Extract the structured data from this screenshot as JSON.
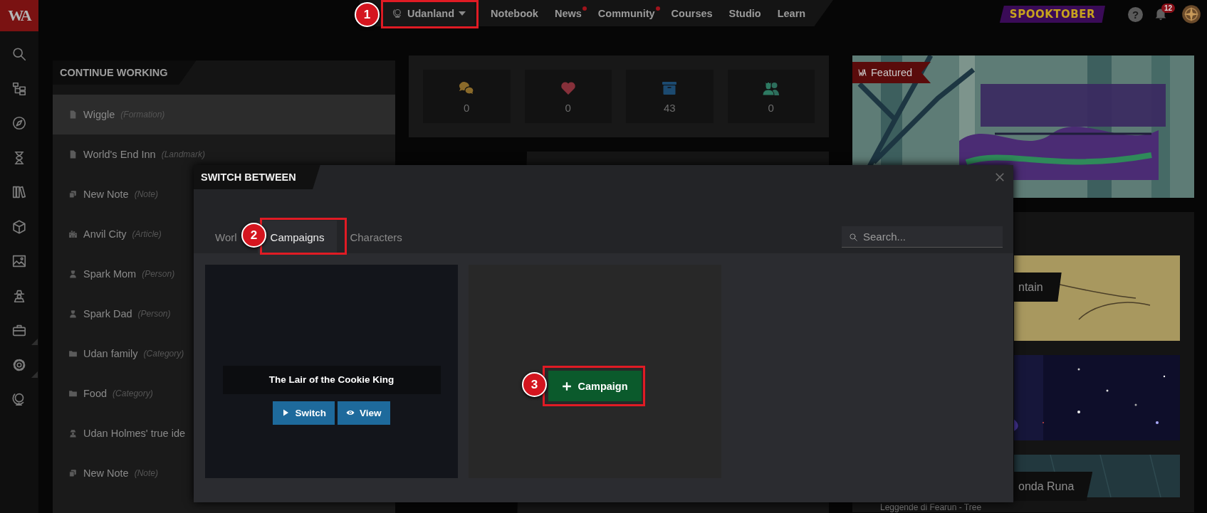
{
  "topbar": {
    "logo": "WA",
    "world": {
      "label": "Udanland"
    },
    "nav": [
      {
        "label": "Notebook",
        "unread": false
      },
      {
        "label": "News",
        "unread": true
      },
      {
        "label": "Community",
        "unread": true
      },
      {
        "label": "Courses",
        "unread": false
      },
      {
        "label": "Studio",
        "unread": false
      },
      {
        "label": "Learn",
        "unread": false
      }
    ],
    "event_banner": "SPOOKTOBER",
    "help": "?",
    "notification_count": "12"
  },
  "continue_working": {
    "title": "CONTINUE WORKING",
    "items": [
      {
        "kind": "document",
        "name": "Wiggle",
        "type": "(Formation)",
        "selected": true
      },
      {
        "kind": "document",
        "name": "World's End Inn",
        "type": "(Landmark)",
        "selected": false
      },
      {
        "kind": "note",
        "name": "New Note",
        "type": "(Note)",
        "selected": false
      },
      {
        "kind": "city",
        "name": "Anvil City",
        "type": "(Article)",
        "selected": false
      },
      {
        "kind": "person",
        "name": "Spark Mom",
        "type": "(Person)",
        "selected": false
      },
      {
        "kind": "person",
        "name": "Spark Dad",
        "type": "(Person)",
        "selected": false
      },
      {
        "kind": "folder",
        "name": "Udan family",
        "type": "(Category)",
        "selected": false
      },
      {
        "kind": "folder",
        "name": "Food",
        "type": "(Category)",
        "selected": false
      },
      {
        "kind": "secret",
        "name": "Udan Holmes' true ide",
        "selected": false
      },
      {
        "kind": "note",
        "name": "New Note",
        "type": "(Note)",
        "selected": false
      }
    ]
  },
  "stats": [
    {
      "kind": "comments",
      "value": "0"
    },
    {
      "kind": "likes",
      "value": "0"
    },
    {
      "kind": "archive",
      "value": "43"
    },
    {
      "kind": "followers",
      "value": "0"
    }
  ],
  "featured": {
    "kind": "picture",
    "ribbon": "Featured"
  },
  "articles": [
    {
      "kind": "picture",
      "title": "ntain"
    },
    {
      "kind": "picture"
    },
    {
      "kind": "picture",
      "title": "onda Runa"
    }
  ],
  "article_caption": "Leggende di Fearun - Tree",
  "modal": {
    "title": "SWITCH BETWEEN",
    "tabs": [
      {
        "label": "Worl",
        "selected": false
      },
      {
        "label": "Campaigns",
        "selected": true
      },
      {
        "label": "Characters",
        "selected": false
      }
    ],
    "search": {
      "placeholder": "Search..."
    },
    "campaigns": [
      {
        "title": "The Lair of the Cookie King",
        "actions": [
          {
            "kind": "switch",
            "label": "Switch"
          },
          {
            "kind": "view",
            "label": "View"
          }
        ]
      }
    ],
    "add_button": "Campaign"
  },
  "annotations": [
    {
      "number": "1"
    },
    {
      "number": "2"
    },
    {
      "number": "3"
    }
  ]
}
